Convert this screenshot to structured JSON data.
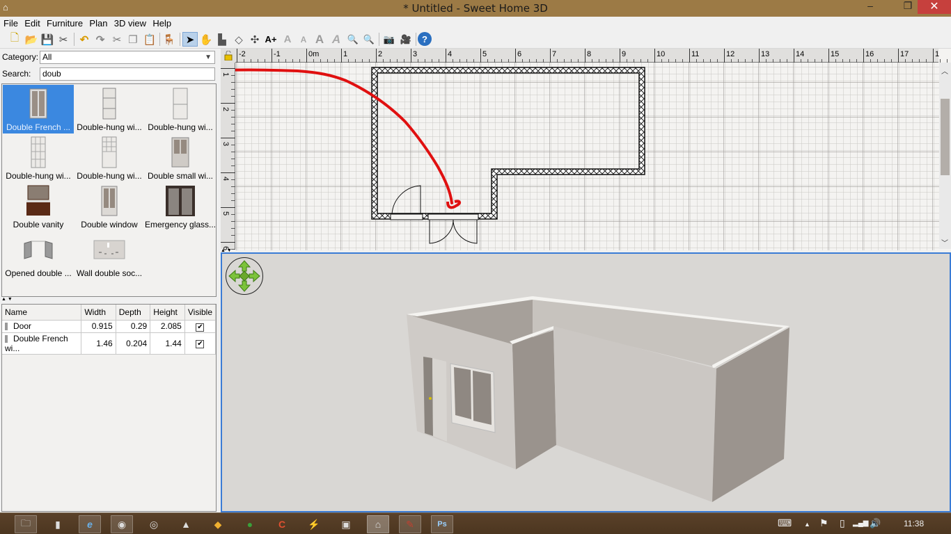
{
  "window": {
    "title": "* Untitled - Sweet Home 3D",
    "controls": {
      "minimize": "–",
      "maximize": "❐",
      "close": "✕"
    }
  },
  "menu": [
    "File",
    "Edit",
    "Furniture",
    "Plan",
    "3D view",
    "Help"
  ],
  "toolbar": [
    {
      "name": "new-home-icon",
      "glyph": "🗋"
    },
    {
      "name": "open-icon",
      "glyph": "📂"
    },
    {
      "name": "save-icon",
      "glyph": "💾"
    },
    {
      "name": "preferences-icon",
      "glyph": "✂"
    },
    {
      "name": "undo-icon",
      "glyph": "↶"
    },
    {
      "name": "redo-icon",
      "glyph": "↷"
    },
    {
      "name": "cut-icon",
      "glyph": "✂"
    },
    {
      "name": "copy-icon",
      "glyph": "❐"
    },
    {
      "name": "paste-icon",
      "glyph": "📋"
    },
    {
      "name": "add-furniture-icon",
      "glyph": "🪑"
    },
    {
      "name": "select-mode-icon",
      "glyph": "➤"
    },
    {
      "name": "pan-mode-icon",
      "glyph": "✋"
    },
    {
      "name": "create-walls-icon",
      "glyph": "▙"
    },
    {
      "name": "create-rooms-icon",
      "glyph": "◇"
    },
    {
      "name": "create-dimensions-icon",
      "glyph": "✣"
    },
    {
      "name": "add-text-icon",
      "glyph": "A+"
    },
    {
      "name": "increase-text-icon",
      "glyph": "A"
    },
    {
      "name": "decrease-text-icon",
      "glyph": "A"
    },
    {
      "name": "bold-text-icon",
      "glyph": "A"
    },
    {
      "name": "italic-text-icon",
      "glyph": "A"
    },
    {
      "name": "zoom-in-icon",
      "glyph": "🔍"
    },
    {
      "name": "zoom-out-icon",
      "glyph": "🔍"
    },
    {
      "name": "create-photo-icon",
      "glyph": "📷"
    },
    {
      "name": "create-video-icon",
      "glyph": "🎥"
    },
    {
      "name": "help-icon",
      "glyph": "?"
    }
  ],
  "catalog": {
    "category_label": "Category:",
    "category_value": "All",
    "search_label": "Search:",
    "search_value": "doub",
    "items": [
      {
        "label": "Double French ...",
        "selected": true
      },
      {
        "label": "Double-hung wi..."
      },
      {
        "label": "Double-hung wi..."
      },
      {
        "label": "Double-hung wi..."
      },
      {
        "label": "Double-hung wi..."
      },
      {
        "label": "Double small wi..."
      },
      {
        "label": "Double vanity"
      },
      {
        "label": "Double window"
      },
      {
        "label": "Emergency glass..."
      },
      {
        "label": "Opened double ..."
      },
      {
        "label": "Wall double soc..."
      }
    ]
  },
  "furniture_table": {
    "columns": [
      "Name",
      "Width",
      "Depth",
      "Height",
      "Visible"
    ],
    "rows": [
      {
        "name": "Door",
        "width": "0.915",
        "depth": "0.29",
        "height": "2.085",
        "visible": true
      },
      {
        "name": "Double French wi...",
        "width": "1.46",
        "depth": "0.204",
        "height": "1.44",
        "visible": true
      }
    ]
  },
  "plan": {
    "h_ruler": [
      "-2",
      "-1",
      "0m",
      "1",
      "2",
      "3",
      "4",
      "5",
      "6",
      "7",
      "8",
      "9",
      "10",
      "11",
      "12",
      "13",
      "14",
      "15",
      "16",
      "17",
      "1"
    ],
    "v_ruler": [
      "1",
      "2",
      "3",
      "4",
      "5",
      "6"
    ],
    "annotation_color": "#e01010"
  },
  "taskbar": {
    "apps": [
      {
        "name": "file-explorer-icon",
        "glyph": "🗀",
        "open": true
      },
      {
        "name": "notepad-icon",
        "glyph": "▮",
        "open": false
      },
      {
        "name": "internet-explorer-icon",
        "glyph": "e",
        "open": true
      },
      {
        "name": "firefox-icon",
        "glyph": "◉",
        "open": true
      },
      {
        "name": "chrome-icon",
        "glyph": "◎",
        "open": false
      },
      {
        "name": "vlc-icon",
        "glyph": "▲",
        "open": false
      },
      {
        "name": "winamp-icon",
        "glyph": "◆",
        "open": false
      },
      {
        "name": "download-manager-icon",
        "glyph": "●",
        "open": false
      },
      {
        "name": "ccleaner-icon",
        "glyph": "C",
        "open": false
      },
      {
        "name": "power-app-icon",
        "glyph": "⚡",
        "open": false
      },
      {
        "name": "remote-desktop-icon",
        "glyph": "▣",
        "open": false
      },
      {
        "name": "sweet-home-3d-icon",
        "glyph": "⌂",
        "open": true
      },
      {
        "name": "paint-app-icon",
        "glyph": "✎",
        "open": true
      },
      {
        "name": "photoshop-icon",
        "glyph": "Ps",
        "open": true
      }
    ],
    "tray": {
      "keyboard": "⌨",
      "show_hidden": "▲",
      "flag": "⚑",
      "battery": "▯",
      "signal": "▂▄▆",
      "volume": "🔊",
      "clock": "11:38"
    }
  }
}
